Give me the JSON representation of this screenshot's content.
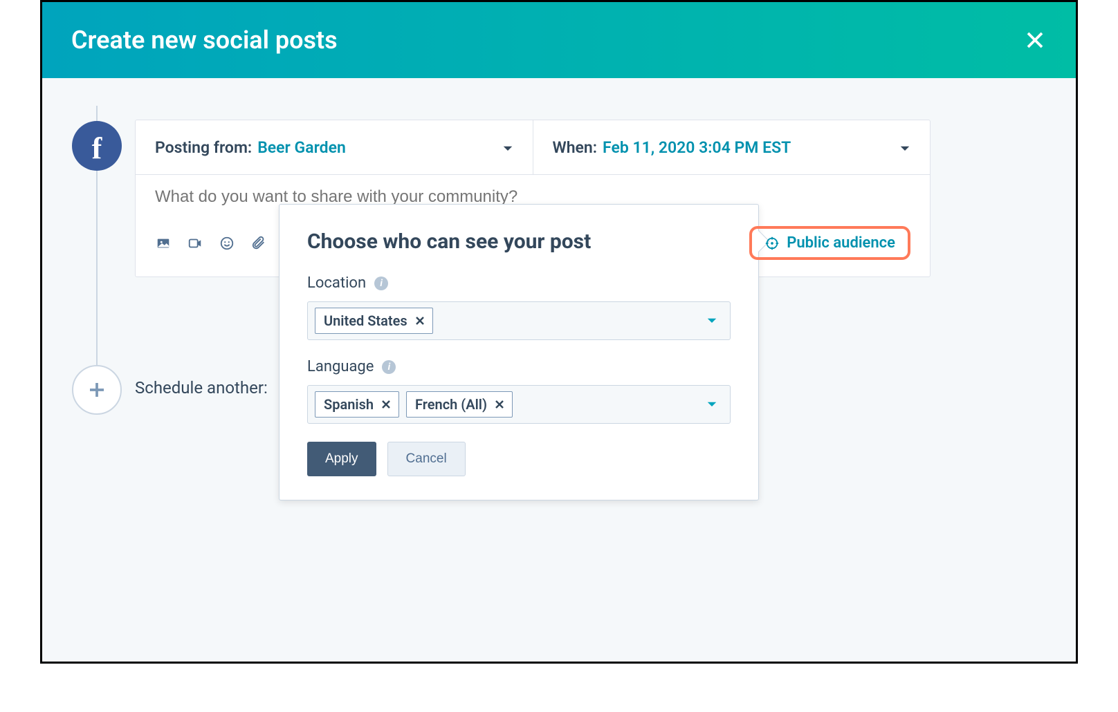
{
  "header": {
    "title": "Create new social posts"
  },
  "post": {
    "network_icon": "f",
    "posting_from_label": "Posting from:",
    "posting_from_value": "Beer Garden",
    "when_label": "When:",
    "when_value": "Feb 11, 2020 3:04 PM EST",
    "content_placeholder": "What do you want to share with your community?"
  },
  "toolbar": {
    "audience_label": "Public audience"
  },
  "schedule_another_label": "Schedule another:",
  "popover": {
    "title": "Choose who can see your post",
    "location_label": "Location",
    "location_chips": [
      "United States"
    ],
    "language_label": "Language",
    "language_chips": [
      "Spanish",
      "French (All)"
    ],
    "apply_label": "Apply",
    "cancel_label": "Cancel"
  }
}
